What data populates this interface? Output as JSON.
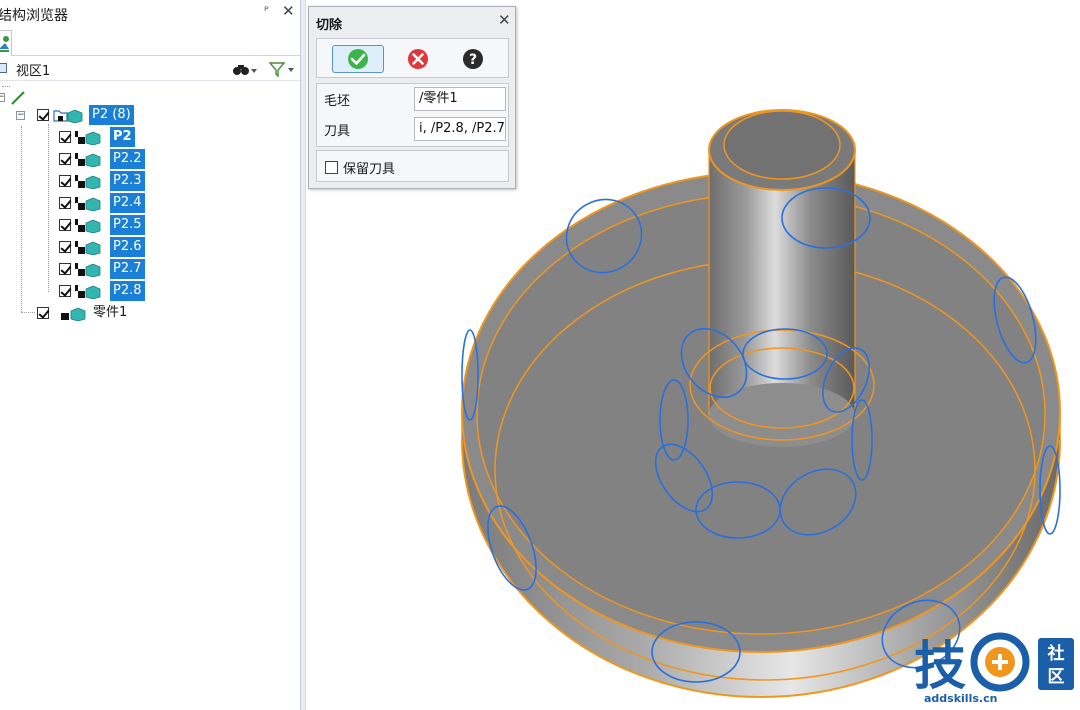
{
  "browser": {
    "title": "结构浏览器",
    "viewport_label": "视区1",
    "tree": [
      {
        "label": "P2 (8)",
        "highlighted": true
      },
      {
        "label": "P2",
        "highlighted": true,
        "bold": true
      },
      {
        "label": "P2.2",
        "highlighted": true
      },
      {
        "label": "P2.3",
        "highlighted": true
      },
      {
        "label": "P2.4",
        "highlighted": true
      },
      {
        "label": "P2.5",
        "highlighted": true
      },
      {
        "label": "P2.6",
        "highlighted": true
      },
      {
        "label": "P2.7",
        "highlighted": true
      },
      {
        "label": "P2.8",
        "highlighted": true
      },
      {
        "label": "零件1",
        "highlighted": false
      }
    ]
  },
  "dialog": {
    "title": "切除",
    "blank_label": "毛坯",
    "blank_value": "/零件1",
    "tool_label": "刀具",
    "tool_value": "i, /P2.8, /P2.7",
    "keep_tool_label": "保留刀具",
    "keep_tool_checked": false
  },
  "watermark": {
    "text": "技",
    "badge": "社区",
    "url": "addskills.cn"
  },
  "colors": {
    "selection": "#1a7fd6",
    "edge_highlight": "#f0961e",
    "tool_outline": "#2a6fe0",
    "model_gray": "#7d7d7d"
  }
}
